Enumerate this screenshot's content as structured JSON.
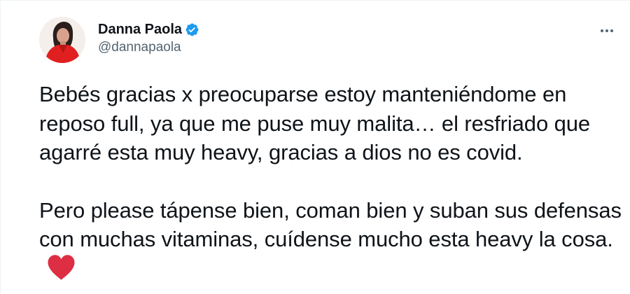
{
  "author": {
    "display_name": "Danna Paola",
    "handle": "@dannapaola",
    "verified": true,
    "verified_icon": "verified-badge-icon",
    "avatar_icon": "profile-photo"
  },
  "menu": {
    "icon": "more-options-icon"
  },
  "tweet": {
    "paragraph_1": "Bebés gracias x preocuparse estoy manteniéndome en reposo full, ya que me puse muy malita… el resfriado que agarré esta muy heavy, gracias a dios no es covid.",
    "paragraph_2": "Pero please tápense bien, coman bien y suban sus defensas con muchas vitaminas, cuídense mucho esta heavy la cosa.",
    "emoji": "red-heart-emoji"
  },
  "colors": {
    "text": "#0f1419",
    "secondary_text": "#536471",
    "verified_blue": "#1d9bf0",
    "heart_red": "#e0245e",
    "avatar_red": "#e02020"
  }
}
